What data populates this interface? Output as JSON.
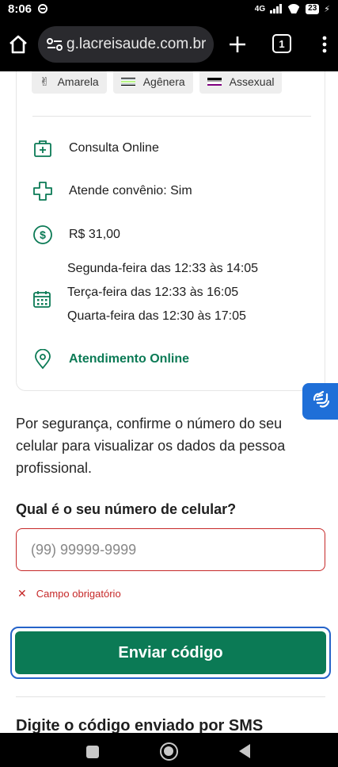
{
  "status_bar": {
    "time": "8:06",
    "network": "4G",
    "battery": "23"
  },
  "browser": {
    "url": "g.lacreisaude.com.br",
    "tab_count": "1"
  },
  "profile_card": {
    "chips": [
      {
        "label": "Amarela",
        "icon": "raised-hand-icon"
      },
      {
        "label": "Agênera",
        "icon": "agender-flag-icon"
      },
      {
        "label": "Assexual",
        "icon": "asexual-flag-icon"
      }
    ],
    "consulta": "Consulta Online",
    "convenio": "Atende convênio: Sim",
    "price": "R$ 31,00",
    "schedule": [
      "Segunda-feira das 12:33 às 14:05",
      "Terça-feira das 12:33 às 16:05",
      "Quarta-feira das 12:30 às 17:05"
    ],
    "location": "Atendimento Online"
  },
  "verification": {
    "security_text": "Por segurança, confirme o número do seu celular para visualizar os dados da pessoa profissional.",
    "phone_label": "Qual é o seu número de celular?",
    "phone_placeholder": "(99) 99999-9999",
    "phone_value": "",
    "error_text": "Campo obrigatório",
    "send_button": "Enviar código",
    "sms_title": "Digite o código enviado por SMS"
  },
  "colors": {
    "brand_green": "#0b7a55",
    "error_red": "#c62828",
    "focus_blue": "#2563c9",
    "accessibility_blue": "#1f6fd8"
  }
}
